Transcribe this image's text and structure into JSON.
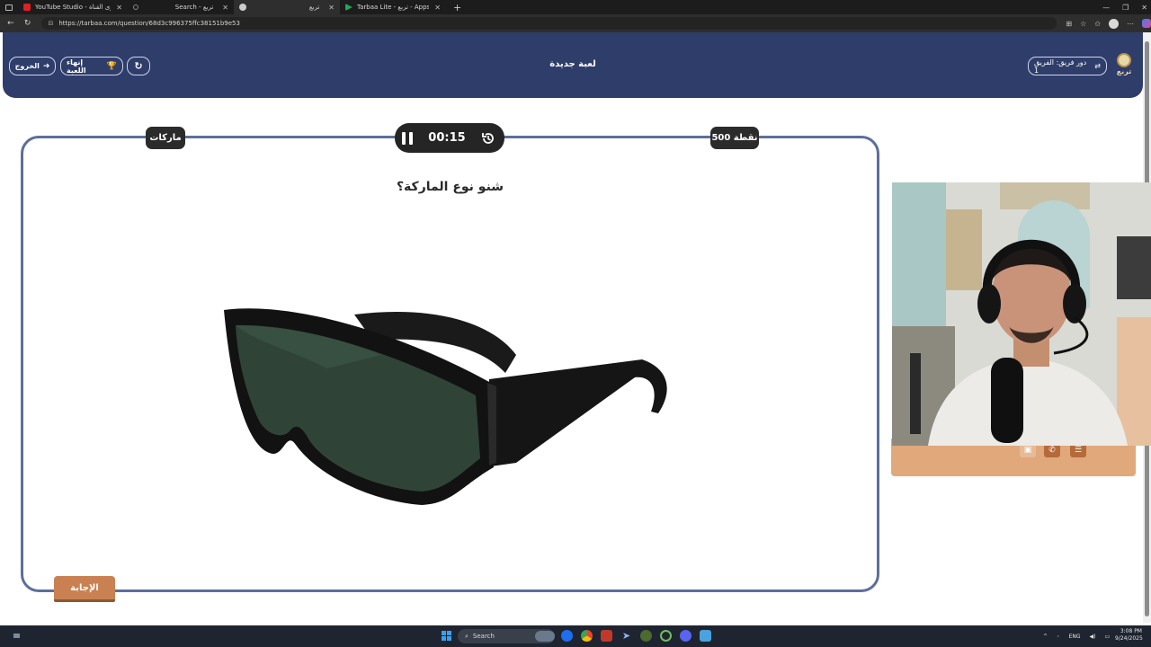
{
  "browser": {
    "tabs": [
      {
        "title": "YouTube Studio - محتوى القناة",
        "favicon_color": "#e21f26"
      },
      {
        "title": "Search - تربع",
        "favicon_color": "#6b6b6b"
      },
      {
        "title": "تربع",
        "favicon_color": "#cccccc"
      },
      {
        "title": "Tarbaa Lite - تربع - Apps on Goog",
        "favicon_color": "#22a65a"
      }
    ],
    "new_tab": "+",
    "url": "https://tarbaa.com/question/68d3c996375ffc38151b9e53"
  },
  "header": {
    "logo_text": "تربع",
    "rotate_team_label": "دور فريق: الفريق 1",
    "game_title": "لعبة جديدة",
    "exit_label": "الخروج",
    "end_game_label": "إنهاء اللعبة"
  },
  "question_card": {
    "points_label": "500 نقطة",
    "category_label": "ماركات",
    "timer": "00:15",
    "question_text": "شنو نوع الماركة؟",
    "answer_label": "الإجابة"
  },
  "taskbar": {
    "search_placeholder": "Search",
    "language": "ENG",
    "time": "3:08 PM",
    "date": "9/24/2025"
  },
  "colors": {
    "header_bg": "#2f3d6a",
    "card_border": "#5d6e9c",
    "answer_button": "#c98151",
    "dark_pill": "#2b2b2b"
  }
}
